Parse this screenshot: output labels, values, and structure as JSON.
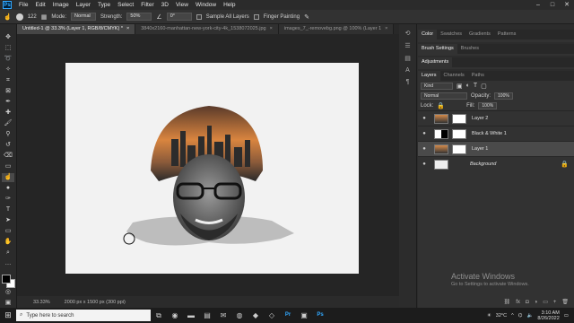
{
  "menubar": {
    "logo": "Ps",
    "items": [
      "File",
      "Edit",
      "Image",
      "Layer",
      "Type",
      "Select",
      "Filter",
      "3D",
      "View",
      "Window",
      "Help"
    ]
  },
  "options": {
    "brush_size": "122",
    "mode_label": "Mode:",
    "mode_value": "Normal",
    "strength_label": "Strength:",
    "strength_value": "50%",
    "angle_value": "0°",
    "sample_all": "Sample All Layers",
    "finger_painting": "Finger Painting"
  },
  "tabs": [
    "Untitled-1 @ 33.3% (Layer 1, RGB/8/CMYK) *",
    "3840x2160-manhattan-new-york-city-4k_1538072025.jpg",
    "images_7_-removebg.png @ 100% (Layer 1"
  ],
  "status": {
    "zoom": "33.33%",
    "doc": "2000 px x 1500 px (300 ppi)"
  },
  "panels": {
    "top_tabs": [
      "Color",
      "Swatches",
      "Gradients",
      "Patterns"
    ],
    "brush_tabs": [
      "Brush Settings",
      "Brushes"
    ],
    "adjust_tabs": [
      "Adjustments"
    ],
    "layer_tabs": [
      "Layers",
      "Channels",
      "Paths"
    ]
  },
  "layers_panel": {
    "kind": "Kind",
    "blend": "Normal",
    "opacity_label": "Opacity:",
    "opacity": "100%",
    "lock_label": "Lock:",
    "fill_label": "Fill:",
    "fill": "100%",
    "layers": [
      {
        "name": "Layer 2"
      },
      {
        "name": "Black & White 1"
      },
      {
        "name": "Layer 1"
      },
      {
        "name": "Background"
      }
    ]
  },
  "watermark": {
    "title": "Activate Windows",
    "subtitle": "Go to Settings to activate Windows."
  },
  "taskbar": {
    "search_placeholder": "Type here to search",
    "temp": "32°C",
    "time": "3:10 AM",
    "date": "8/26/2022"
  }
}
